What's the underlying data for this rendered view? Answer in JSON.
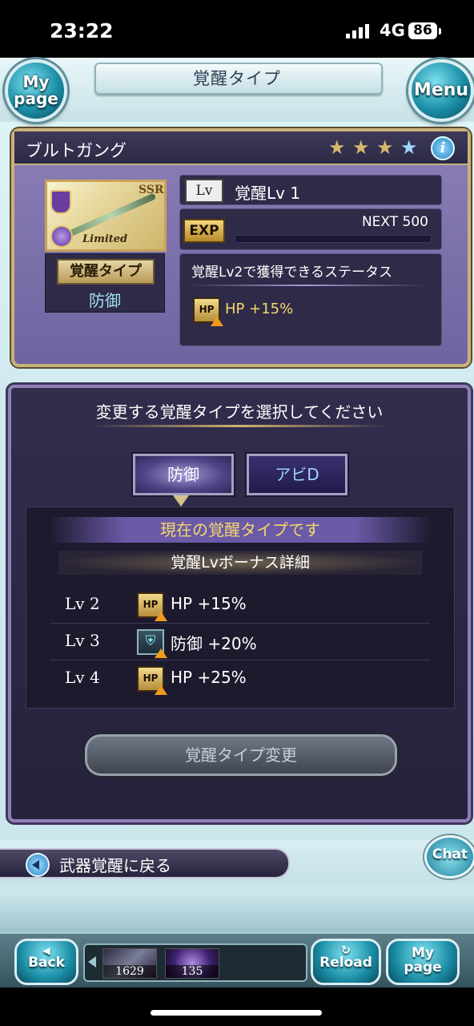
{
  "status_bar": {
    "time": "23:22",
    "network": "4G",
    "battery": "86"
  },
  "header": {
    "title": "覚醒タイプ",
    "mypage_label": "My page",
    "menu_label": "Menu"
  },
  "weapon": {
    "name": "ブルトガング",
    "rarity_badge": "SSR",
    "limited_label": "Limited",
    "stars": [
      "★",
      "★",
      "★",
      "★"
    ],
    "awakening_label": "覚醒タイプ",
    "awakening_value": "防御",
    "lv_tag": "Lv",
    "lv_value": "覚醒Lv 1",
    "exp_tag": "EXP",
    "next_text": "NEXT 500",
    "status_heading": "覚醒Lv2で獲得できるステータス",
    "status_icon": "HP",
    "status_text": "HP +15%"
  },
  "selection": {
    "prompt": "変更する覚醒タイプを選択してください",
    "tabs": [
      {
        "label": "防御"
      },
      {
        "label": "アビD"
      }
    ],
    "current_banner": "現在の覚醒タイプです",
    "detail_heading": "覚醒Lvボーナス詳細",
    "bonuses": [
      {
        "lv": "Lv 2",
        "icon": "HP",
        "text": "HP +15%"
      },
      {
        "lv": "Lv 3",
        "icon": "defense-icon",
        "text": "防御 +20%"
      },
      {
        "lv": "Lv 4",
        "icon": "HP",
        "text": "HP +25%"
      }
    ],
    "change_button": "覚醒タイプ変更"
  },
  "nav": {
    "back_link": "武器覚醒に戻る",
    "chat": "Chat",
    "back_btn": "Back",
    "reload_btn": "Reload",
    "mypage_btn": "My page",
    "items": [
      {
        "count": "1629"
      },
      {
        "count": "135"
      }
    ]
  }
}
